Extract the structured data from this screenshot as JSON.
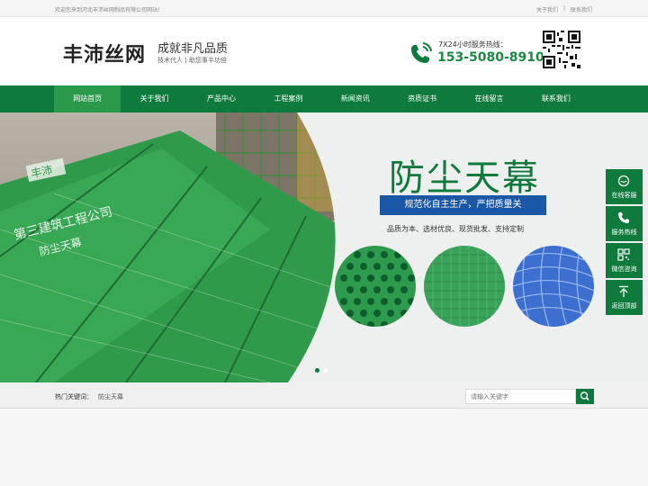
{
  "topbar": {
    "welcome": "欢迎您来到河北丰沛丝网制品有限公司网站！",
    "about": "关于我们",
    "sep": "|",
    "contact": "联系我们"
  },
  "header": {
    "logo": "丰沛丝网",
    "slogan_main": "成就非凡品质",
    "slogan_sub": "技术代人丨助您事半功倍",
    "hotline_label": "7X24小时服务热线：",
    "hotline_number": "153-5080-8910"
  },
  "nav": {
    "items": [
      "网站首页",
      "关于我们",
      "产品中心",
      "工程案例",
      "新闻资讯",
      "资质证书",
      "在线留言",
      "联系我们"
    ],
    "active_index": 0
  },
  "banner": {
    "title": "防尘天幕",
    "ribbon": "规范化自主生产，严把质量关",
    "tagline": "品质为本、选材优良、现货批发、支持定制",
    "photo_text_1": "丰沛",
    "photo_text_2": "第三建筑工程公司",
    "photo_text_3": "防尘天幕",
    "slide_count": 2,
    "active_slide": 0
  },
  "hot": {
    "label": "热门关键词：",
    "keyword": "防尘天幕",
    "search_placeholder": "请输入关键字"
  },
  "sidebar": {
    "items": [
      "在线客服",
      "服务热线",
      "微信咨询",
      "返回顶部"
    ]
  },
  "colors": {
    "primary_green": "#0e7a3c",
    "hotline_green": "#1a8a44",
    "ribbon_blue": "#1a57a6"
  }
}
